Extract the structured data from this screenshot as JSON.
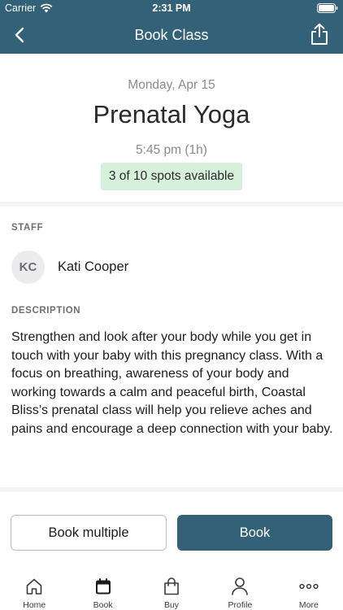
{
  "status_bar": {
    "carrier": "Carrier",
    "time": "2:31 PM"
  },
  "nav": {
    "title": "Book Class",
    "back_icon": "chevron-left-icon",
    "share_icon": "share-icon"
  },
  "class": {
    "date": "Monday, Apr 15",
    "name": "Prenatal Yoga",
    "time": "5:45 pm (1h)",
    "spots": "3 of 10 spots available"
  },
  "staff": {
    "label": "STAFF",
    "initials": "KC",
    "name": "Kati Cooper"
  },
  "description": {
    "label": "DESCRIPTION",
    "text": "Strengthen and look after your body while you get in touch with your baby with this pregnancy class. With a focus on breathing, awareness of your body and working towards a calm and peaceful birth, Coastal Bliss’s prenatal class will help you relieve aches and pains and encourage a deep connection with your baby."
  },
  "actions": {
    "book_multiple": "Book multiple",
    "book": "Book"
  },
  "tabs": [
    {
      "label": "Home",
      "icon": "home-icon"
    },
    {
      "label": "Book",
      "icon": "calendar-icon",
      "active": true
    },
    {
      "label": "Buy",
      "icon": "shopping-bag-icon"
    },
    {
      "label": "Profile",
      "icon": "person-icon"
    },
    {
      "label": "More",
      "icon": "more-dots-icon"
    }
  ],
  "colors": {
    "brand": "#336178",
    "spots_badge": "#d7f0dc"
  }
}
